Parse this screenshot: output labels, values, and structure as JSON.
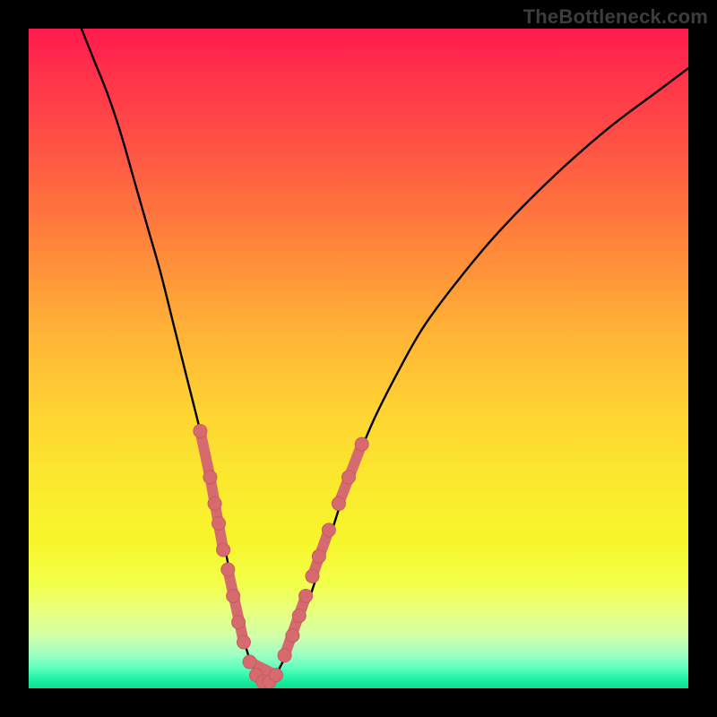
{
  "watermark": "TheBottleneck.com",
  "colors": {
    "background": "#000000",
    "curve": "#000000",
    "marker_fill": "#d56b6f",
    "marker_stroke": "#c85a5e"
  },
  "chart_data": {
    "type": "line",
    "title": "",
    "xlabel": "",
    "ylabel": "",
    "xlim": [
      0,
      100
    ],
    "ylim": [
      0,
      100
    ],
    "series": [
      {
        "name": "bottleneck-curve",
        "x": [
          8,
          10,
          12,
          14,
          16,
          18,
          20,
          22,
          24,
          26,
          28,
          30,
          31,
          32,
          33,
          34,
          35,
          36,
          37,
          38,
          40,
          42,
          44,
          46,
          48,
          52,
          56,
          60,
          66,
          72,
          80,
          88,
          96,
          100
        ],
        "y": [
          100,
          95,
          90,
          84,
          77,
          70,
          63,
          55,
          47,
          39,
          30,
          20,
          15,
          10,
          6,
          3,
          1,
          0.5,
          1,
          3,
          7,
          12,
          18,
          24,
          30,
          40,
          48,
          55,
          63,
          70,
          78,
          85,
          91,
          94
        ]
      }
    ],
    "markers": [
      {
        "name": "left-cluster-top",
        "x": 26.0,
        "y": 39
      },
      {
        "name": "left-cluster-a",
        "x": 27.5,
        "y": 32
      },
      {
        "name": "left-cluster-b",
        "x": 28.2,
        "y": 28
      },
      {
        "name": "left-cluster-c",
        "x": 28.8,
        "y": 25
      },
      {
        "name": "left-cluster-d",
        "x": 29.5,
        "y": 21
      },
      {
        "name": "left-cluster-e",
        "x": 30.2,
        "y": 18
      },
      {
        "name": "left-cluster-f",
        "x": 31.0,
        "y": 14
      },
      {
        "name": "left-cluster-g",
        "x": 31.8,
        "y": 10
      },
      {
        "name": "left-cluster-h",
        "x": 32.6,
        "y": 7
      },
      {
        "name": "left-cluster-i",
        "x": 33.5,
        "y": 4
      },
      {
        "name": "trough-a",
        "x": 34.5,
        "y": 2
      },
      {
        "name": "trough-b",
        "x": 35.5,
        "y": 1
      },
      {
        "name": "trough-c",
        "x": 36.5,
        "y": 1
      },
      {
        "name": "trough-d",
        "x": 37.5,
        "y": 2
      },
      {
        "name": "right-cluster-a",
        "x": 38.8,
        "y": 5
      },
      {
        "name": "right-cluster-b",
        "x": 40.0,
        "y": 8
      },
      {
        "name": "right-cluster-c",
        "x": 41.0,
        "y": 11
      },
      {
        "name": "right-cluster-d",
        "x": 42.0,
        "y": 14
      },
      {
        "name": "right-cluster-e",
        "x": 43.0,
        "y": 17
      },
      {
        "name": "right-cluster-f",
        "x": 44.0,
        "y": 20
      },
      {
        "name": "right-cluster-g",
        "x": 45.5,
        "y": 24
      },
      {
        "name": "right-cluster-h",
        "x": 47.0,
        "y": 28
      },
      {
        "name": "right-cluster-i",
        "x": 48.5,
        "y": 32
      },
      {
        "name": "right-cluster-top",
        "x": 50.5,
        "y": 37
      }
    ],
    "connector_segments": [
      {
        "from": 0,
        "to": 1
      },
      {
        "from": 1,
        "to": 4
      },
      {
        "from": 5,
        "to": 8
      },
      {
        "from": 9,
        "to": 13
      },
      {
        "from": 14,
        "to": 17
      },
      {
        "from": 18,
        "to": 20
      },
      {
        "from": 21,
        "to": 23
      }
    ]
  }
}
